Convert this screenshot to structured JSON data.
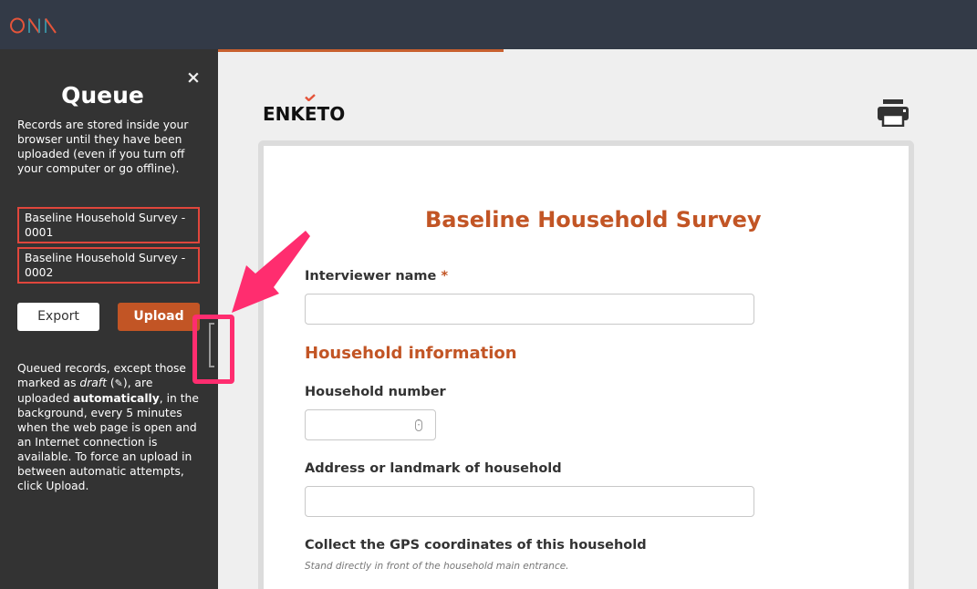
{
  "topbar": {
    "brand": "ONA",
    "brand_colors": {
      "orange": "#e4543a",
      "teal": "#3a8c9c"
    },
    "background": "#333a47"
  },
  "progress": {
    "fraction": 0.376,
    "color": "#c8602f"
  },
  "queue": {
    "close_label": "×",
    "title": "Queue",
    "description": "Records are stored inside your browser until they have been uploaded (even if you turn off your computer or go offline).",
    "records": [
      {
        "label": "Baseline Household Survey - 0001"
      },
      {
        "label": "Baseline Household Survey - 0002"
      }
    ],
    "export_label": "Export",
    "upload_label": "Upload",
    "note": {
      "part1": "Queued records, except those marked as ",
      "draft": "draft",
      "draft_icon": "pencil-icon",
      "part2": ", are uploaded ",
      "automatically": "automatically",
      "part3": ", in the background, every 5 minutes when the web page is open and an Internet connection is available. To force an upload in between automatic attempts, click Upload."
    },
    "accent": "#c25525",
    "record_border": "#e0463c"
  },
  "main": {
    "logo_text": "ENKETO",
    "print_icon": "printer-icon",
    "form": {
      "title": "Baseline Household Survey",
      "fields": [
        {
          "label": "Interviewer name",
          "required_mark": "*",
          "value": ""
        },
        {
          "section": "Household information"
        },
        {
          "label": "Household number",
          "value": ""
        },
        {
          "label": "Address or landmark of household",
          "value": ""
        },
        {
          "label": "Collect the GPS coordinates of this household",
          "hint": "Stand directly in front of the household main entrance."
        }
      ]
    }
  },
  "annotation": {
    "color": "#ff2d6f",
    "target": "sidebar-toggle-handle"
  }
}
